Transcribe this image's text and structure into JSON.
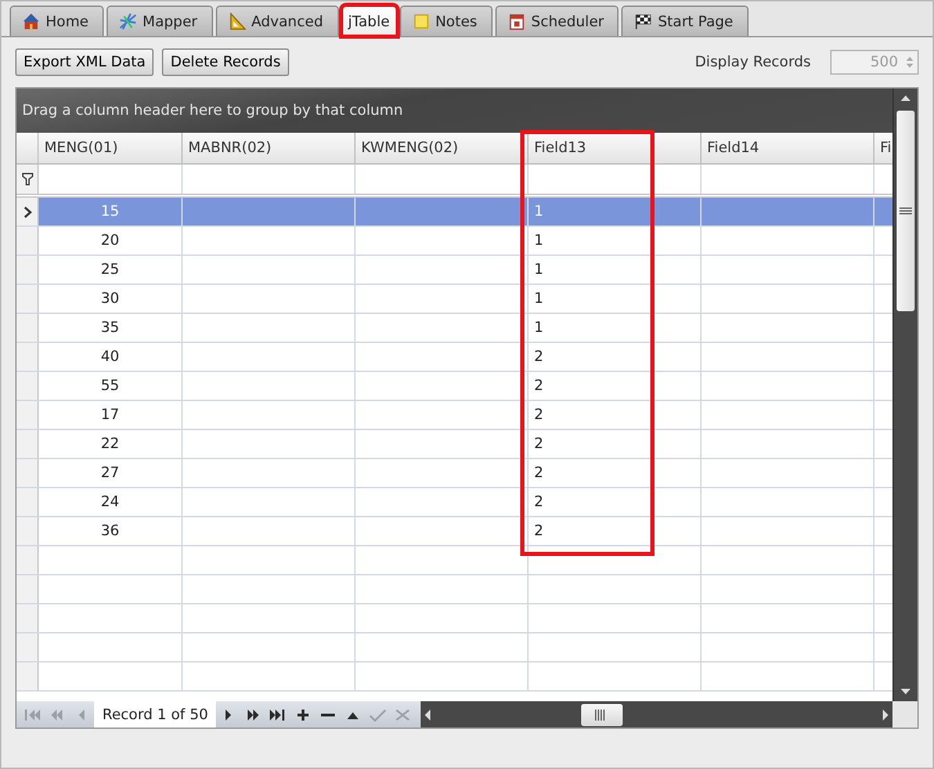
{
  "tabs": [
    {
      "label": "Home",
      "kind": "home",
      "selected": false,
      "highlighted": false
    },
    {
      "label": "Mapper",
      "kind": "mapper",
      "selected": false,
      "highlighted": false
    },
    {
      "label": "Advanced",
      "kind": "ruler",
      "selected": false,
      "highlighted": false
    },
    {
      "label": "jTable",
      "selected": true,
      "highlighted": true
    },
    {
      "label": "Notes",
      "kind": "note",
      "selected": false,
      "highlighted": false
    },
    {
      "label": "Scheduler",
      "kind": "calendar",
      "selected": false,
      "highlighted": false
    },
    {
      "label": "Start Page",
      "kind": "flag",
      "selected": false,
      "highlighted": false
    }
  ],
  "toolbar": {
    "buttons": [
      "Export XML Data",
      "Delete Records"
    ],
    "display_records": {
      "label": "Display Records",
      "value": "500",
      "disabled": true
    }
  },
  "grid": {
    "group_panel": "Drag a column header here to group by that column",
    "columns": [
      {
        "label": "MENG(01)",
        "highlighted": false
      },
      {
        "label": "MABNR(02)",
        "highlighted": false
      },
      {
        "label": "KWMENG(02)",
        "highlighted": false
      },
      {
        "label": "Field13",
        "highlighted": true
      },
      {
        "label": "Field14",
        "highlighted": false
      },
      {
        "label": "Fi",
        "highlighted": false
      }
    ],
    "rows": [
      {
        "selected": true,
        "cells": [
          "15",
          null,
          null,
          "1",
          null,
          null
        ]
      },
      {
        "selected": false,
        "cells": [
          "20",
          null,
          null,
          "1",
          null,
          null
        ]
      },
      {
        "selected": false,
        "cells": [
          "25",
          null,
          null,
          "1",
          null,
          null
        ]
      },
      {
        "selected": false,
        "cells": [
          "30",
          null,
          null,
          "1",
          null,
          null
        ]
      },
      {
        "selected": false,
        "cells": [
          "35",
          null,
          null,
          "1",
          null,
          null
        ]
      },
      {
        "selected": false,
        "cells": [
          "40",
          null,
          null,
          "2",
          null,
          null
        ]
      },
      {
        "selected": false,
        "cells": [
          "55",
          null,
          null,
          "2",
          null,
          null
        ]
      },
      {
        "selected": false,
        "cells": [
          "17",
          null,
          null,
          "2",
          null,
          null
        ]
      },
      {
        "selected": false,
        "cells": [
          "22",
          null,
          null,
          "2",
          null,
          null
        ]
      },
      {
        "selected": false,
        "cells": [
          "27",
          null,
          null,
          "2",
          null,
          null
        ]
      },
      {
        "selected": false,
        "cells": [
          "24",
          null,
          null,
          "2",
          null,
          null
        ]
      },
      {
        "selected": false,
        "cells": [
          "36",
          null,
          null,
          "2",
          null,
          null
        ]
      }
    ],
    "navigator": {
      "record_text": "Record 1 of 50",
      "buttons": [
        {
          "kind": "first",
          "disabled": true
        },
        {
          "kind": "prev_page",
          "disabled": true
        },
        {
          "kind": "prev",
          "disabled": true
        },
        {
          "kind": "next",
          "disabled": false
        },
        {
          "kind": "next_page",
          "disabled": false
        },
        {
          "kind": "last",
          "disabled": false
        },
        {
          "kind": "add",
          "disabled": false
        },
        {
          "kind": "remove",
          "disabled": false
        },
        {
          "kind": "edit",
          "disabled": false
        },
        {
          "kind": "save",
          "disabled": true
        },
        {
          "kind": "cancel",
          "disabled": true
        }
      ]
    }
  }
}
